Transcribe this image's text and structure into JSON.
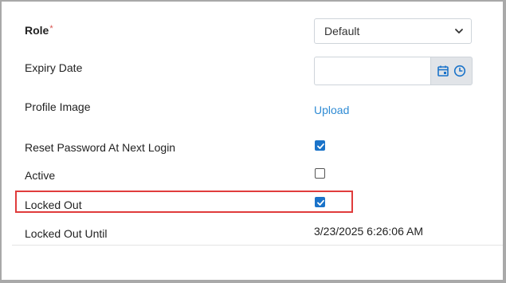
{
  "form": {
    "role": {
      "label": "Role",
      "required_marker": "*",
      "selected": "Default"
    },
    "expiry_date": {
      "label": "Expiry Date",
      "value": ""
    },
    "profile_image": {
      "label": "Profile Image",
      "upload_link": "Upload"
    },
    "reset_password": {
      "label": "Reset Password At Next Login",
      "checked": true
    },
    "active": {
      "label": "Active",
      "checked": false
    },
    "locked_out": {
      "label": "Locked Out",
      "checked": true
    },
    "locked_out_until": {
      "label": "Locked Out Until",
      "value": "3/23/2025 6:26:06 AM"
    }
  },
  "colors": {
    "accent": "#1a73c9",
    "link": "#2f8bd4",
    "highlight_border": "#e03c3c",
    "required": "#d9534f"
  },
  "icons": {
    "chevron": "chevron-down-icon",
    "calendar": "calendar-icon",
    "clock": "clock-icon"
  }
}
